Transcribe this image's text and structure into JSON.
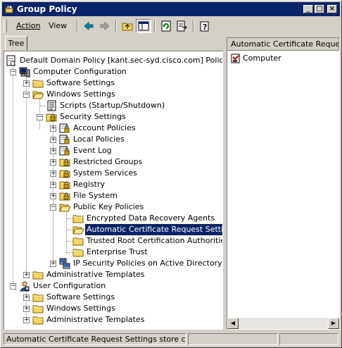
{
  "window": {
    "title": "Group Policy"
  },
  "menu": {
    "action": "Action",
    "view": "View"
  },
  "tabs": {
    "tree": "Tree"
  },
  "tree": {
    "root": "Default Domain Policy [kant.sec-syd.cisco.com] Policy",
    "computer_configuration": "Computer Configuration",
    "cc_software_settings": "Software Settings",
    "cc_windows_settings": "Windows Settings",
    "scripts": "Scripts (Startup/Shutdown)",
    "security_settings": "Security Settings",
    "account_policies": "Account Policies",
    "local_policies": "Local Policies",
    "event_log": "Event Log",
    "restricted_groups": "Restricted Groups",
    "system_services": "System Services",
    "registry": "Registry",
    "file_system": "File System",
    "public_key_policies": "Public Key Policies",
    "encrypted_data_recovery_agents": "Encrypted Data Recovery Agents",
    "automatic_certificate_request_settings": "Automatic Certificate Request Settings",
    "trusted_root_certification_authorities": "Trusted Root Certification Authorities",
    "enterprise_trust": "Enterprise Trust",
    "ip_security_policies": "IP Security Policies on Active Directory",
    "cc_administrative_templates": "Administrative Templates",
    "user_configuration": "User Configuration",
    "uc_software_settings": "Software Settings",
    "uc_windows_settings": "Windows Settings",
    "uc_administrative_templates": "Administrative Templates"
  },
  "details": {
    "column_header": "Automatic Certificate Request",
    "items": [
      "Computer"
    ]
  },
  "status": {
    "text": "Automatic Certificate Request Settings store contains"
  },
  "colors": {
    "titlebar": "#0a246a",
    "selection": "#0a246a",
    "face": "#d4d0c8"
  }
}
